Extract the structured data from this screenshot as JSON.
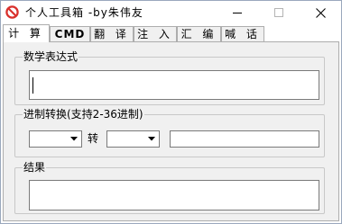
{
  "window": {
    "title": "个人工具箱 -by朱伟友"
  },
  "tabs": [
    {
      "label": "计 算",
      "active": true
    },
    {
      "label": "CMD",
      "active": false
    },
    {
      "label": "翻 译",
      "active": false
    },
    {
      "label": "注 入",
      "active": false
    },
    {
      "label": "汇 编",
      "active": false
    },
    {
      "label": "喊 话",
      "active": false
    }
  ],
  "calculator": {
    "expression_group": "数学表达式",
    "expression_value": "",
    "base_group": "进制转换(支持2-36进制)",
    "from_base": "",
    "to_label": "转",
    "to_base": "",
    "converted_value": "",
    "result_group": "结果",
    "result_value": ""
  },
  "icons": {
    "app": "prohibited-icon",
    "minimize": "minimize-icon",
    "maximize": "maximize-icon",
    "close": "close-icon",
    "dropdown": "chevron-down-icon"
  },
  "colors": {
    "app_icon_red": "#d9302c",
    "panel_bg": "#f0f0f0"
  }
}
